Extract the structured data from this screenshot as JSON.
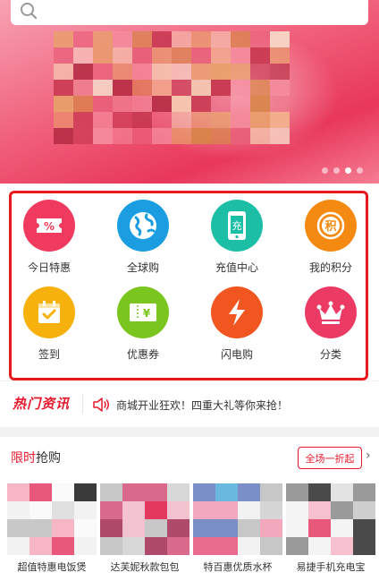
{
  "search": {
    "placeholder": ""
  },
  "banner": {
    "slide_count": 4,
    "active_slide": 3
  },
  "categories": [
    {
      "label": "今日特惠",
      "icon": "ticket-icon",
      "color": "#f03a5f",
      "glyph": "%"
    },
    {
      "label": "全球购",
      "icon": "globe-icon",
      "color": "#1b9de2",
      "glyph": ""
    },
    {
      "label": "充值中心",
      "icon": "phone-recharge-icon",
      "color": "#1cbfa6",
      "glyph": "充"
    },
    {
      "label": "我的积分",
      "icon": "points-icon",
      "color": "#f58a13",
      "glyph": "积"
    },
    {
      "label": "签到",
      "icon": "calendar-check-icon",
      "color": "#f7b10d",
      "glyph": ""
    },
    {
      "label": "优惠券",
      "icon": "coupon-icon",
      "color": "#7ac51e",
      "glyph": "¥"
    },
    {
      "label": "闪电购",
      "icon": "lightning-icon",
      "color": "#f25620",
      "glyph": ""
    },
    {
      "label": "分类",
      "icon": "crown-icon",
      "color": "#eb3a64",
      "glyph": ""
    }
  ],
  "news": {
    "badge": "热门资讯",
    "message": "商城开业狂欢！四重大礼等你来抢！"
  },
  "flash_sale": {
    "title_highlight": "限时",
    "title_rest": "抢购",
    "all_button": "全场一折起",
    "products": [
      {
        "name": "超值特惠电饭煲"
      },
      {
        "name": "达芙妮秋款包包"
      },
      {
        "name": "特百惠优质水杯"
      },
      {
        "name": "易捷手机充电宝"
      }
    ]
  },
  "colors": {
    "accent": "#e8192c",
    "banner": "#f05f7a"
  }
}
